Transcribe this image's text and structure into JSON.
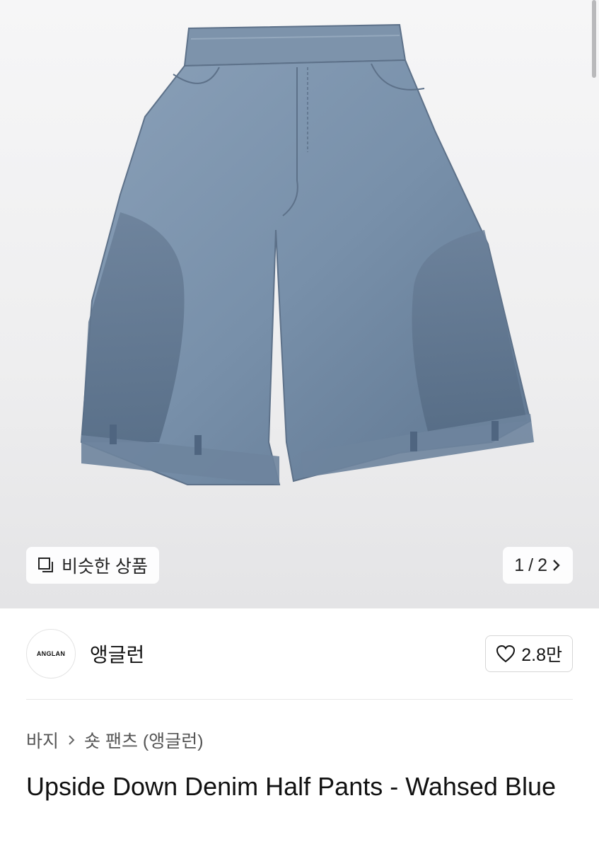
{
  "hero": {
    "similar_label": "비슷한 상품",
    "similar_icon": "similar-products-icon",
    "pager": {
      "current": "1",
      "separator": "/",
      "total": "2"
    }
  },
  "brand": {
    "logo_text": "ANGLAN",
    "name": "앵글런",
    "likes": "2.8만"
  },
  "breadcrumb": {
    "category": "바지",
    "subcategory": "숏 팬츠 (앵글런)"
  },
  "product": {
    "title": "Upside Down Denim Half Pants - Wahsed Blue"
  },
  "colors": {
    "denim": "#6f86a0",
    "background": "#eeeeef"
  }
}
